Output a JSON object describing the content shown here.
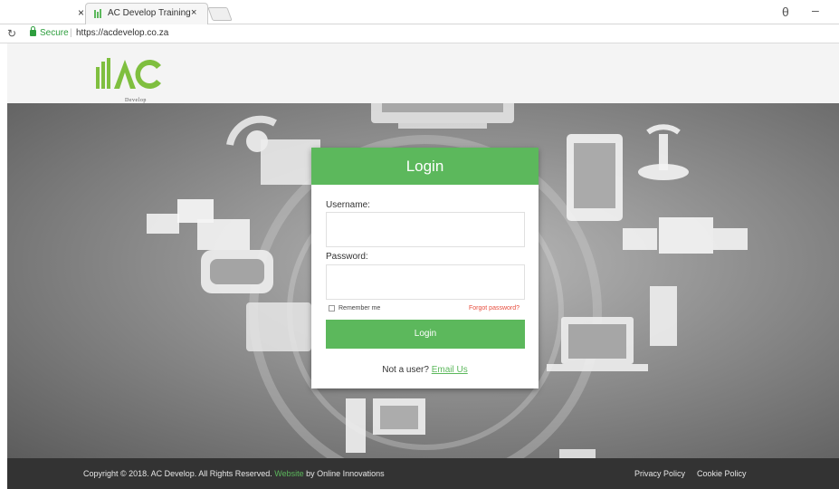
{
  "browser": {
    "prev_tab_close": "×",
    "tab_title": "AC Develop Training",
    "tab_close": "×",
    "secure_label": "Secure",
    "address_separator": "|",
    "url": "https://acdevelop.co.za",
    "profile_glyph": "θ",
    "minimize_glyph": "–"
  },
  "header": {
    "logo_subtext": "Develop"
  },
  "login": {
    "title": "Login",
    "username_label": "Username:",
    "password_label": "Password:",
    "remember_label": "Remember me",
    "forgot_label": "Forgot password?",
    "button_label": "Login",
    "not_user_text": "Not a user? ",
    "email_link": "Email Us"
  },
  "footer": {
    "copyright": "Copyright © 2018. AC Develop. All Rights Reserved. ",
    "website_link": "Website",
    "by_text": " by Online Innovations",
    "privacy": "Privacy Policy",
    "cookie": "Cookie Policy"
  },
  "colors": {
    "brand_green": "#5cb85c",
    "secure_green": "#2e9e3e",
    "forgot_red": "#e74c3c",
    "footer_bg": "#333333"
  }
}
